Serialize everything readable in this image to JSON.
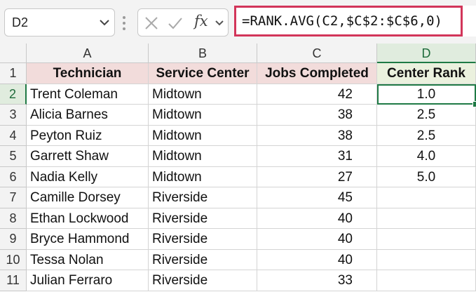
{
  "name_box": {
    "value": "D2"
  },
  "formula_bar": {
    "formula": "=RANK.AVG(C2,$C$2:$C$6,0)",
    "fx_label": "fx"
  },
  "columns": [
    "A",
    "B",
    "C",
    "D"
  ],
  "header_row": {
    "row_number": "1",
    "cells": [
      "Technician",
      "Service Center",
      "Jobs Completed",
      "Center Rank"
    ]
  },
  "rows": [
    {
      "row_number": "2",
      "technician": "Trent Coleman",
      "center": "Midtown",
      "jobs": "42",
      "rank": "1.0"
    },
    {
      "row_number": "3",
      "technician": "Alicia Barnes",
      "center": "Midtown",
      "jobs": "38",
      "rank": "2.5"
    },
    {
      "row_number": "4",
      "technician": "Peyton Ruiz",
      "center": "Midtown",
      "jobs": "38",
      "rank": "2.5"
    },
    {
      "row_number": "5",
      "technician": "Garrett Shaw",
      "center": "Midtown",
      "jobs": "31",
      "rank": "4.0"
    },
    {
      "row_number": "6",
      "technician": "Nadia Kelly",
      "center": "Midtown",
      "jobs": "27",
      "rank": "5.0"
    },
    {
      "row_number": "7",
      "technician": "Camille Dorsey",
      "center": "Riverside",
      "jobs": "45",
      "rank": ""
    },
    {
      "row_number": "8",
      "technician": "Ethan Lockwood",
      "center": "Riverside",
      "jobs": "40",
      "rank": ""
    },
    {
      "row_number": "9",
      "technician": "Bryce Hammond",
      "center": "Riverside",
      "jobs": "40",
      "rank": ""
    },
    {
      "row_number": "10",
      "technician": "Tessa Nolan",
      "center": "Riverside",
      "jobs": "40",
      "rank": ""
    },
    {
      "row_number": "11",
      "technician": "Julian Ferraro",
      "center": "Riverside",
      "jobs": "33",
      "rank": ""
    }
  ],
  "colors": {
    "header_fill": "#f2dcdb",
    "rank_header_fill": "#ebf1de",
    "selection": "#1f7a45",
    "formula_highlight": "#d2355a"
  },
  "icons": [
    "chevron-down-icon",
    "cancel-icon",
    "enter-icon",
    "chevron-down-icon"
  ]
}
